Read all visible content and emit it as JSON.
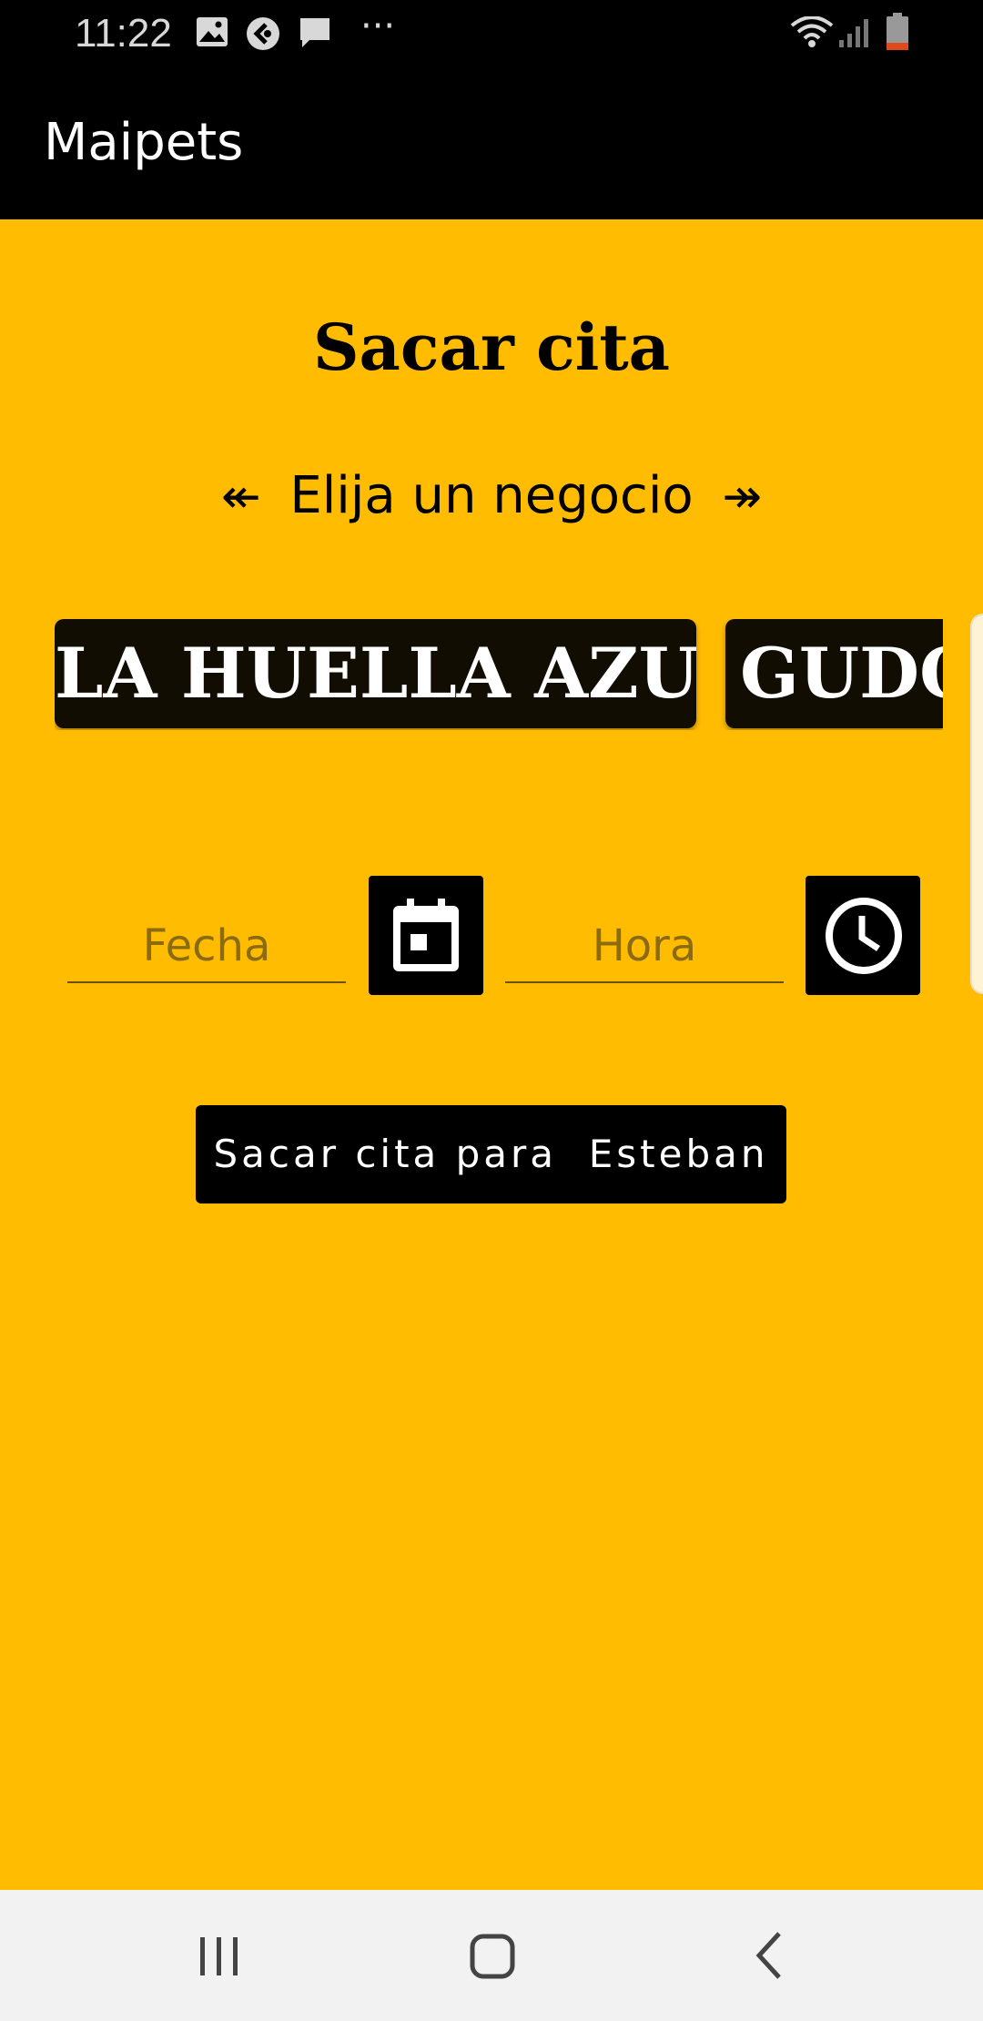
{
  "status_bar": {
    "time": "11:22",
    "left_icons": [
      "image-icon",
      "circle-app-icon",
      "chat-icon",
      "more-dots-icon"
    ],
    "right_icons": [
      "wifi-icon",
      "signal-icon",
      "battery-icon"
    ],
    "more_glyph": "···"
  },
  "app_bar": {
    "title": "Maipets"
  },
  "main": {
    "title": "Sacar cita",
    "chooser": {
      "left_arrow": "↞",
      "label": "Elija un negocio",
      "right_arrow": "↠"
    },
    "businesses": [
      {
        "name": "LA HUELLA AZUL"
      },
      {
        "name": "GUDO"
      }
    ],
    "date_field": {
      "placeholder": "Fecha",
      "icon": "calendar-icon"
    },
    "time_field": {
      "placeholder": "Hora",
      "icon": "clock-icon"
    },
    "submit_label": "Sacar cita para  Esteban"
  },
  "nav_bar": {
    "items": [
      "recent-apps-icon",
      "home-icon",
      "back-icon"
    ]
  },
  "colors": {
    "background": "#ffbc00",
    "bar": "#000000",
    "card": "#120d02",
    "placeholder": "#8a6b12"
  }
}
